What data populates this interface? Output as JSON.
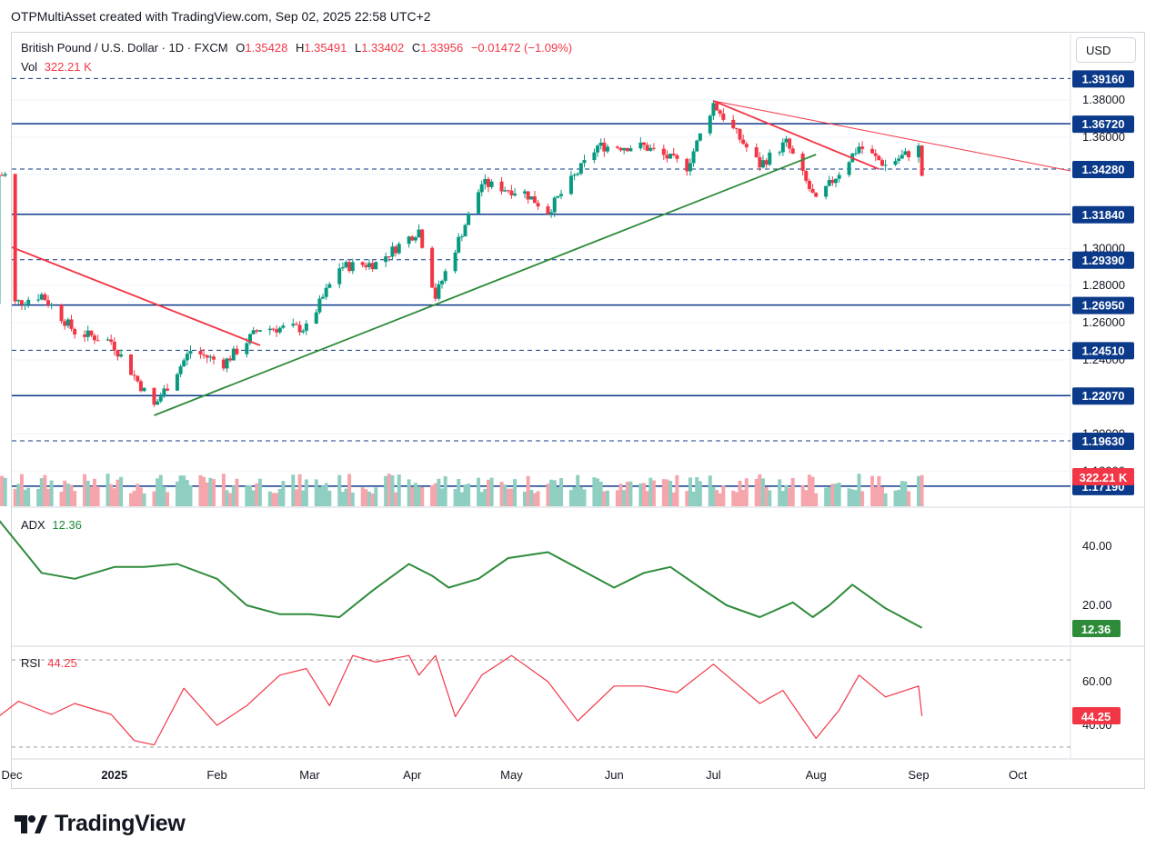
{
  "header": {
    "created_by": "OTPMultiAsset created with TradingView.com, Sep 02, 2025 22:58 UTC+2"
  },
  "currency_button": "USD",
  "legend": {
    "symbol": "British Pound / U.S. Dollar · 1D · FXCM",
    "o_label": "O",
    "o_value": "1.35428",
    "h_label": "H",
    "h_value": "1.35491",
    "l_label": "L",
    "l_value": "1.33402",
    "c_label": "C",
    "c_value": "1.33956",
    "change": "−0.01472 (−1.09%)",
    "vol_label": "Vol",
    "vol_value": "322.21 K"
  },
  "adx_legend": {
    "label": "ADX",
    "value": "12.36"
  },
  "rsi_legend": {
    "label": "RSI",
    "value": "44.25"
  },
  "footer": {
    "brand": "TradingView"
  },
  "colors": {
    "up": "#089981",
    "down": "#f23645",
    "level": "#0c3a8a",
    "adx": "#2e8b3a",
    "rsi": "#f23645",
    "trend_green": "#2e8b3a",
    "trend_red": "#f23645"
  },
  "chart_data": [
    {
      "type": "candlestick",
      "title": "British Pound / U.S. Dollar · 1D · FXCM",
      "x_tick_labels": [
        "Dec",
        "2025",
        "Feb",
        "Mar",
        "Apr",
        "May",
        "Jun",
        "Jul",
        "Aug",
        "Sep",
        "Oct"
      ],
      "y_tick_labels": [
        "1.38000",
        "1.36000",
        "1.30000",
        "1.28000",
        "1.26000",
        "1.24000",
        "1.20000",
        "1.18000"
      ],
      "price_levels": [
        {
          "value": "1.39160",
          "style": "dashed"
        },
        {
          "value": "1.36720",
          "style": "solid"
        },
        {
          "value": "1.34280",
          "style": "dashed"
        },
        {
          "value": "1.31840",
          "style": "solid"
        },
        {
          "value": "1.29390",
          "style": "dashed"
        },
        {
          "value": "1.26950",
          "style": "solid"
        },
        {
          "value": "1.24510",
          "style": "dashed"
        },
        {
          "value": "1.22070",
          "style": "solid"
        },
        {
          "value": "1.19630",
          "style": "dashed"
        },
        {
          "value": "1.17190",
          "style": "solid"
        }
      ],
      "volume_label": "322.21 K",
      "key_prices": [
        {
          "date": "2024-12-01",
          "close": 1.27
        },
        {
          "date": "2024-12-10",
          "close": 1.275
        },
        {
          "date": "2024-12-20",
          "close": 1.255
        },
        {
          "date": "2024-12-31",
          "close": 1.25
        },
        {
          "date": "2025-01-13",
          "close": 1.215
        },
        {
          "date": "2025-01-24",
          "close": 1.245
        },
        {
          "date": "2025-02-03",
          "close": 1.238
        },
        {
          "date": "2025-02-14",
          "close": 1.257
        },
        {
          "date": "2025-02-28",
          "close": 1.257
        },
        {
          "date": "2025-03-10",
          "close": 1.29
        },
        {
          "date": "2025-03-21",
          "close": 1.292
        },
        {
          "date": "2025-04-03",
          "close": 1.31
        },
        {
          "date": "2025-04-08",
          "close": 1.274
        },
        {
          "date": "2025-04-22",
          "close": 1.335
        },
        {
          "date": "2025-05-05",
          "close": 1.33
        },
        {
          "date": "2025-05-12",
          "close": 1.32
        },
        {
          "date": "2025-05-27",
          "close": 1.355
        },
        {
          "date": "2025-06-10",
          "close": 1.355
        },
        {
          "date": "2025-06-23",
          "close": 1.344
        },
        {
          "date": "2025-07-01",
          "close": 1.378
        },
        {
          "date": "2025-07-15",
          "close": 1.345
        },
        {
          "date": "2025-07-23",
          "close": 1.357
        },
        {
          "date": "2025-08-01",
          "close": 1.325
        },
        {
          "date": "2025-08-14",
          "close": 1.355
        },
        {
          "date": "2025-08-22",
          "close": 1.345
        },
        {
          "date": "2025-09-01",
          "close": 1.354
        },
        {
          "date": "2025-09-02",
          "close": 1.33956
        }
      ]
    },
    {
      "type": "line",
      "name": "ADX",
      "y_tick_labels": [
        "40.00",
        "20.00"
      ],
      "current": "12.36",
      "x": [
        "2024-11-27",
        "2024-12-10",
        "2024-12-20",
        "2025-01-01",
        "2025-01-10",
        "2025-01-20",
        "2025-02-01",
        "2025-02-10",
        "2025-02-20",
        "2025-03-01",
        "2025-03-10",
        "2025-03-20",
        "2025-03-31",
        "2025-04-07",
        "2025-04-12",
        "2025-04-21",
        "2025-04-30",
        "2025-05-12",
        "2025-05-22",
        "2025-06-01",
        "2025-06-10",
        "2025-06-18",
        "2025-06-27",
        "2025-07-05",
        "2025-07-15",
        "2025-07-25",
        "2025-07-31",
        "2025-08-05",
        "2025-08-12",
        "2025-08-22",
        "2025-09-02"
      ],
      "y": [
        49,
        31,
        29,
        33,
        33,
        34,
        29,
        20,
        17,
        17,
        16,
        25,
        34,
        30,
        26,
        29,
        36,
        38,
        32,
        26,
        31,
        33,
        26,
        20,
        16,
        21,
        16,
        20,
        27,
        19,
        12.36
      ]
    },
    {
      "type": "line",
      "name": "RSI",
      "y_tick_labels": [
        "60.00",
        "40.00"
      ],
      "current": "44.25",
      "x": [
        "2024-11-27",
        "2024-12-03",
        "2024-12-13",
        "2024-12-20",
        "2024-12-31",
        "2025-01-07",
        "2025-01-13",
        "2025-01-22",
        "2025-02-01",
        "2025-02-10",
        "2025-02-20",
        "2025-02-28",
        "2025-03-07",
        "2025-03-14",
        "2025-03-21",
        "2025-03-31",
        "2025-04-03",
        "2025-04-08",
        "2025-04-14",
        "2025-04-22",
        "2025-05-01",
        "2025-05-12",
        "2025-05-21",
        "2025-06-01",
        "2025-06-10",
        "2025-06-20",
        "2025-07-01",
        "2025-07-08",
        "2025-07-15",
        "2025-07-22",
        "2025-08-01",
        "2025-08-08",
        "2025-08-14",
        "2025-08-22",
        "2025-09-01",
        "2025-09-02"
      ],
      "y": [
        44,
        51,
        45,
        50,
        45,
        33,
        31,
        57,
        40,
        49,
        63,
        66,
        49,
        72,
        69,
        72,
        63,
        72,
        44,
        63,
        72,
        60,
        42,
        58,
        58,
        55,
        68,
        59,
        50,
        56,
        34,
        47,
        63,
        53,
        58,
        44.25
      ]
    }
  ]
}
